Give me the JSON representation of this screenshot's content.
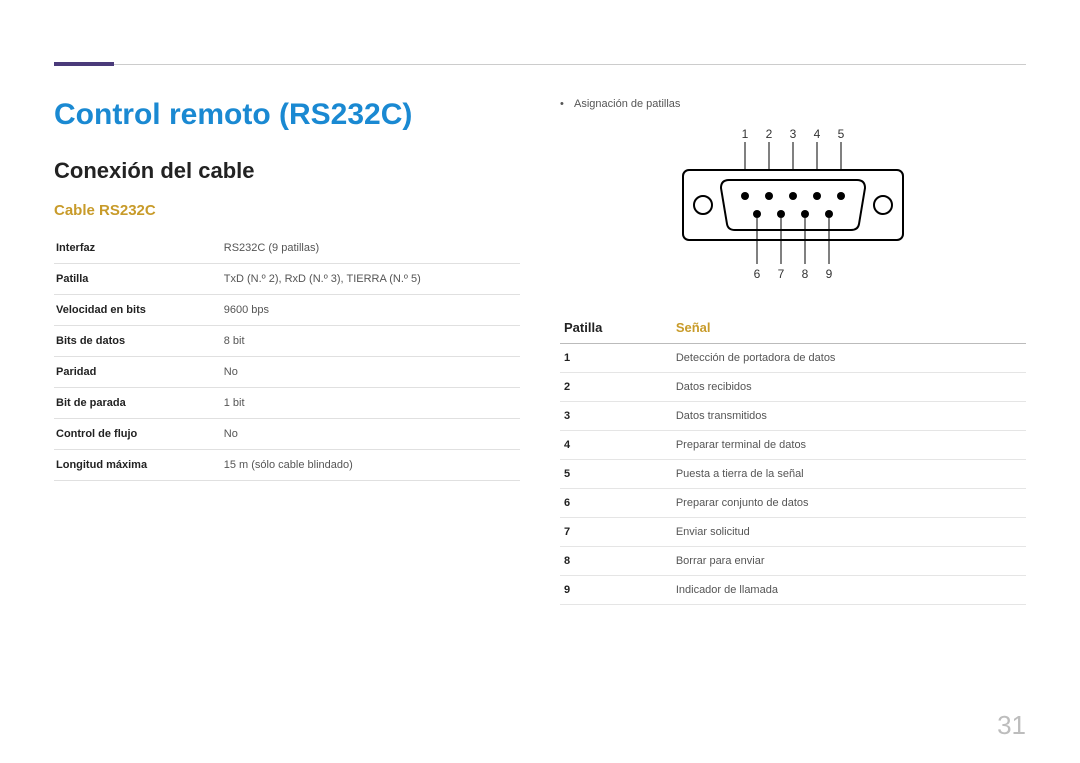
{
  "page_number": "31",
  "title": "Control remoto (RS232C)",
  "section": "Conexión del cable",
  "subsection": "Cable RS232C",
  "spec_rows": [
    {
      "label": "Interfaz",
      "value": "RS232C (9 patillas)"
    },
    {
      "label": "Patilla",
      "value": "TxD (N.º 2), RxD (N.º 3), TIERRA (N.º 5)"
    },
    {
      "label": "Velocidad en bits",
      "value": "9600 bps"
    },
    {
      "label": "Bits de datos",
      "value": "8 bit"
    },
    {
      "label": "Paridad",
      "value": "No"
    },
    {
      "label": "Bit de parada",
      "value": "1 bit"
    },
    {
      "label": "Control de flujo",
      "value": "No"
    },
    {
      "label": "Longitud máxima",
      "value": "15 m (sólo cable blindado)"
    }
  ],
  "right_bullet": "Asignación de patillas",
  "connector": {
    "top_labels": [
      "1",
      "2",
      "3",
      "4",
      "5"
    ],
    "bottom_labels": [
      "6",
      "7",
      "8",
      "9"
    ]
  },
  "pin_table": {
    "head_pin": "Patilla",
    "head_signal": "Señal",
    "rows": [
      {
        "n": "1",
        "s": "Detección de portadora de datos"
      },
      {
        "n": "2",
        "s": "Datos recibidos"
      },
      {
        "n": "3",
        "s": "Datos transmitidos"
      },
      {
        "n": "4",
        "s": "Preparar terminal de datos"
      },
      {
        "n": "5",
        "s": "Puesta a tierra de la señal"
      },
      {
        "n": "6",
        "s": "Preparar conjunto de datos"
      },
      {
        "n": "7",
        "s": "Enviar solicitud"
      },
      {
        "n": "8",
        "s": "Borrar para enviar"
      },
      {
        "n": "9",
        "s": "Indicador de llamada"
      }
    ]
  }
}
